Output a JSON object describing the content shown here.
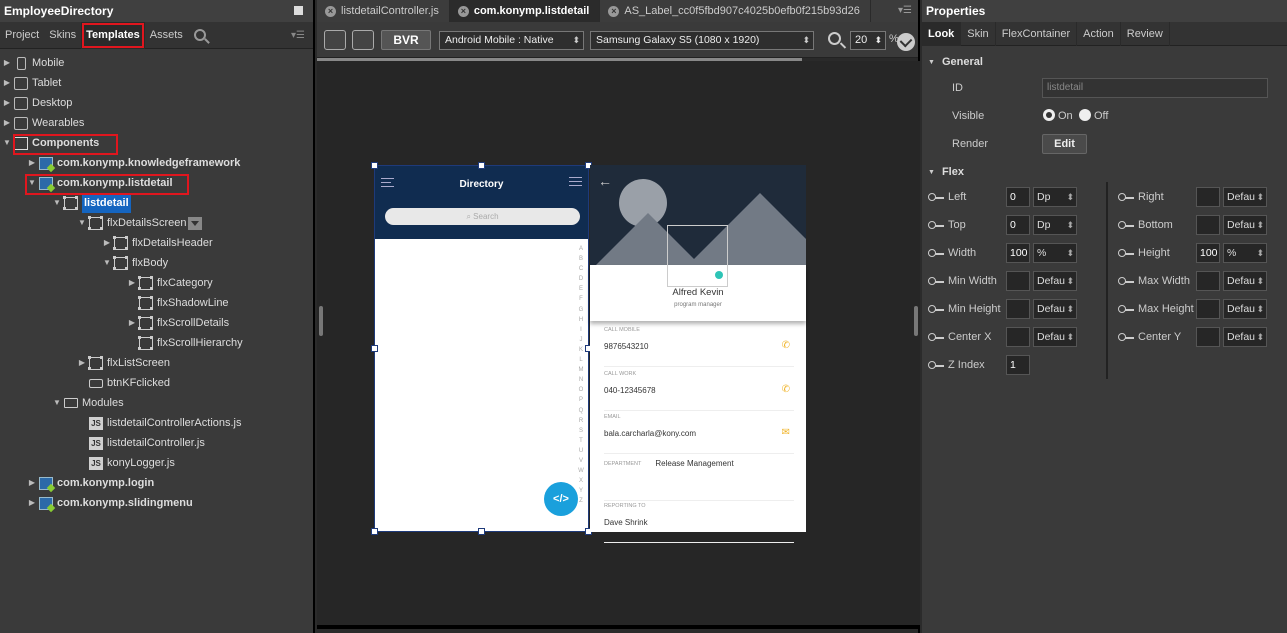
{
  "left": {
    "title": "EmployeeDirectory",
    "tabs": [
      "Project",
      "Skins",
      "Templates",
      "Assets"
    ],
    "active_tab": "Templates",
    "tree": [
      {
        "label": "Mobile",
        "indent": 0,
        "arrow": "▶",
        "icon": "phone-icon",
        "bold": false
      },
      {
        "label": "Tablet",
        "indent": 0,
        "arrow": "▶",
        "icon": "tablet-icon",
        "bold": false
      },
      {
        "label": "Desktop",
        "indent": 0,
        "arrow": "▶",
        "icon": "desktop-icon",
        "bold": false
      },
      {
        "label": "Wearables",
        "indent": 0,
        "arrow": "▶",
        "icon": "watch-icon",
        "bold": false
      },
      {
        "label": "Components",
        "indent": 0,
        "arrow": "▼",
        "icon": "components-icon",
        "bold": true
      },
      {
        "label": "com.konymp.knowledgeframework",
        "indent": 1,
        "arrow": "▶",
        "icon": "component-icon",
        "bold": true
      },
      {
        "label": "com.konymp.listdetail",
        "indent": 1,
        "arrow": "▼",
        "icon": "component-icon",
        "bold": true
      },
      {
        "label": "listdetail",
        "indent": 2,
        "arrow": "▼",
        "icon": "flex-icon",
        "bold": true,
        "selected": true
      },
      {
        "label": "flxDetailsScreen",
        "indent": 3,
        "arrow": "▼",
        "icon": "flex-icon",
        "bold": false,
        "dropdown": true
      },
      {
        "label": "flxDetailsHeader",
        "indent": 4,
        "arrow": "▶",
        "icon": "flex-icon",
        "bold": false
      },
      {
        "label": "flxBody",
        "indent": 4,
        "arrow": "▼",
        "icon": "flex-icon",
        "bold": false
      },
      {
        "label": "flxCategory",
        "indent": 5,
        "arrow": "▶",
        "icon": "flex-icon",
        "bold": false
      },
      {
        "label": "flxShadowLine",
        "indent": 5,
        "arrow": "",
        "icon": "flex-icon",
        "bold": false
      },
      {
        "label": "flxScrollDetails",
        "indent": 5,
        "arrow": "▶",
        "icon": "flex-icon",
        "bold": false
      },
      {
        "label": "flxScrollHierarchy",
        "indent": 5,
        "arrow": "",
        "icon": "flex-icon",
        "bold": false
      },
      {
        "label": "flxListScreen",
        "indent": 3,
        "arrow": "▶",
        "icon": "flex-icon",
        "bold": false
      },
      {
        "label": "btnKFclicked",
        "indent": 3,
        "arrow": "",
        "icon": "button-icon",
        "bold": false
      },
      {
        "label": "Modules",
        "indent": 2,
        "arrow": "▼",
        "icon": "folder-icon",
        "bold": false
      },
      {
        "label": "listdetailControllerActions.js",
        "indent": 3,
        "arrow": "",
        "icon": "js-file-icon",
        "bold": false
      },
      {
        "label": "listdetailController.js",
        "indent": 3,
        "arrow": "",
        "icon": "js-file-icon",
        "bold": false
      },
      {
        "label": "konyLogger.js",
        "indent": 3,
        "arrow": "",
        "icon": "js-file-icon",
        "bold": false
      },
      {
        "label": "com.konymp.login",
        "indent": 1,
        "arrow": "▶",
        "icon": "component-icon",
        "bold": true
      },
      {
        "label": "com.konymp.slidingmenu",
        "indent": 1,
        "arrow": "▶",
        "icon": "component-icon",
        "bold": true
      }
    ]
  },
  "center": {
    "tabs": [
      {
        "label": "listdetailController.js",
        "active": false
      },
      {
        "label": "com.konymp.listdetail",
        "active": true
      },
      {
        "label": "AS_Label_cc0f5fbd907c4025b0efb0f215b93d26",
        "active": false
      }
    ],
    "toolbar": {
      "bvr_label": "BVR",
      "platform": "Android Mobile : Native",
      "device": "Samsung Galaxy S5 (1080 x 1920)",
      "zoom": "20",
      "zoom_suffix": "%"
    },
    "preview_list": {
      "title": "Directory",
      "search_placeholder": "Search",
      "alphabet": [
        "A",
        "B",
        "C",
        "D",
        "E",
        "F",
        "G",
        "H",
        "I",
        "J",
        "K",
        "L",
        "M",
        "N",
        "O",
        "P",
        "Q",
        "R",
        "S",
        "T",
        "U",
        "V",
        "W",
        "X",
        "Y",
        "Z"
      ],
      "fab_label": "</>"
    },
    "preview_detail": {
      "name": "Alfred Kevin",
      "role": "program manager",
      "fields": [
        {
          "label": "CALL MOBILE",
          "value": "9876543210",
          "icon": "phone-icon"
        },
        {
          "label": "CALL WORK",
          "value": "040-12345678",
          "icon": "phone-icon"
        },
        {
          "label": "EMAIL",
          "value": "bala.carcharla@kony.com",
          "icon": "mail-icon"
        },
        {
          "label": "DEPARTMENT",
          "value": "Release Management",
          "icon": ""
        },
        {
          "label": "REPORTING TO",
          "value": "Dave Shrink",
          "icon": ""
        }
      ]
    }
  },
  "right": {
    "title": "Properties",
    "tabs": [
      "Look",
      "Skin",
      "FlexContainer",
      "Action",
      "Review"
    ],
    "active_tab": "Look",
    "general": {
      "section": "General",
      "id_label": "ID",
      "id_value": "listdetail",
      "visible_label": "Visible",
      "on_label": "On",
      "off_label": "Off",
      "render_label": "Render",
      "edit_label": "Edit"
    },
    "flex": {
      "section": "Flex",
      "left_col": [
        {
          "label": "Left",
          "value": "0",
          "unit": "Dp"
        },
        {
          "label": "Top",
          "value": "0",
          "unit": "Dp"
        },
        {
          "label": "Width",
          "value": "100",
          "unit": "%"
        },
        {
          "label": "Min Width",
          "value": "",
          "unit": "Default"
        },
        {
          "label": "Min Height",
          "value": "",
          "unit": "Default"
        },
        {
          "label": "Center X",
          "value": "",
          "unit": "Default"
        },
        {
          "label": "Z Index",
          "value": "1",
          "unit": null
        }
      ],
      "right_col": [
        {
          "label": "Right",
          "value": "",
          "unit": "Default"
        },
        {
          "label": "Bottom",
          "value": "",
          "unit": "Default"
        },
        {
          "label": "Height",
          "value": "100",
          "unit": "%"
        },
        {
          "label": "Max Width",
          "value": "",
          "unit": "Default"
        },
        {
          "label": "Max Height",
          "value": "",
          "unit": "Default"
        },
        {
          "label": "Center Y",
          "value": "",
          "unit": "Default"
        }
      ]
    }
  }
}
